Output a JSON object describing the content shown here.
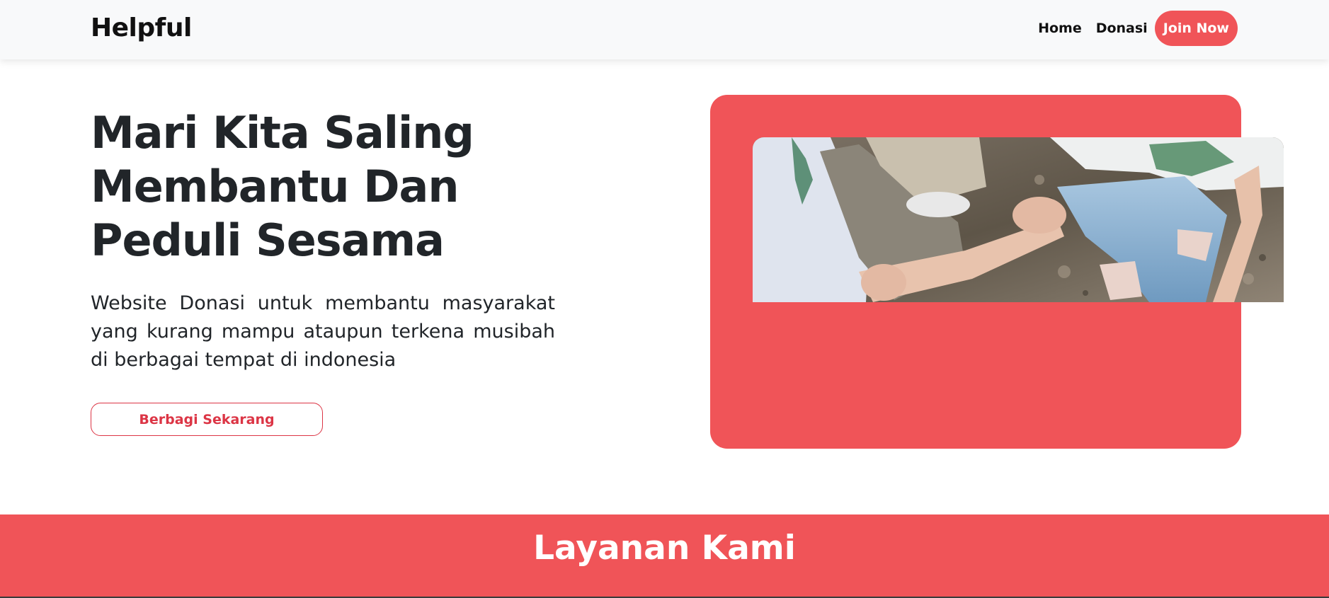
{
  "navbar": {
    "brand": "Helpful",
    "links": [
      {
        "label": "Home"
      },
      {
        "label": "Donasi"
      }
    ],
    "join_label": "Join Now"
  },
  "hero": {
    "title": "Mari Kita Saling Membantu Dan Peduli Sesama",
    "description": "Website Donasi untuk membantu masyarakat yang kurang mampu ataupun terkena musibah di berbagai tempat di indonesia",
    "cta_label": "Berbagi Sekarang",
    "image_subject": "people-helping-hands-photo"
  },
  "services": {
    "title": "Layanan Kami"
  },
  "colors": {
    "accent": "#f05458",
    "accent_border": "#dc3545",
    "navbar_bg": "#f8f9fa",
    "text": "#212529"
  }
}
